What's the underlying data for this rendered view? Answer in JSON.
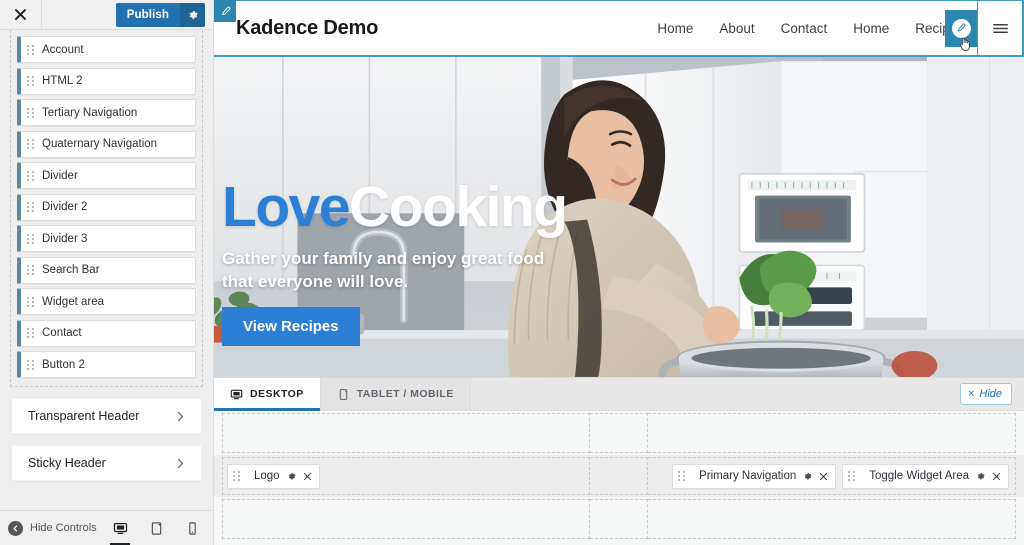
{
  "customizer": {
    "close_label": "Close",
    "publish_label": "Publish",
    "publish_settings_label": "Publish settings",
    "hide_controls_label": "Hide Controls",
    "devices": [
      {
        "name": "desktop",
        "label": "Desktop",
        "active": true
      },
      {
        "name": "tablet",
        "label": "Tablet",
        "active": false
      },
      {
        "name": "mobile",
        "label": "Mobile",
        "active": false
      }
    ]
  },
  "sidebar": {
    "available_items": [
      {
        "label": "Account"
      },
      {
        "label": "HTML 2"
      },
      {
        "label": "Tertiary Navigation"
      },
      {
        "label": "Quaternary Navigation"
      },
      {
        "label": "Divider"
      },
      {
        "label": "Divider 2"
      },
      {
        "label": "Divider 3"
      },
      {
        "label": "Search Bar"
      },
      {
        "label": "Widget area"
      },
      {
        "label": "Contact"
      },
      {
        "label": "Button 2"
      }
    ],
    "panels": [
      {
        "label": "Transparent Header"
      },
      {
        "label": "Sticky Header"
      }
    ]
  },
  "preview": {
    "site_title": "Kadence Demo",
    "nav_items": [
      {
        "label": "Home"
      },
      {
        "label": "About"
      },
      {
        "label": "Contact"
      },
      {
        "label": "Home"
      },
      {
        "label": "Recipes"
      }
    ],
    "hero": {
      "heading_accent": "Love",
      "heading_rest": "Cooking",
      "subheading": "Gather your family and enjoy great food that everyone will love.",
      "button_label": "View Recipes"
    }
  },
  "builder": {
    "tabs": [
      {
        "label": "DESKTOP",
        "active": true
      },
      {
        "label": "TABLET / MOBILE",
        "active": false
      }
    ],
    "hide_label": "Hide",
    "hide_x": "×",
    "rows": [
      {
        "name": "top-row",
        "left": [],
        "center": [],
        "right": []
      },
      {
        "name": "main-row",
        "left": [
          {
            "label": "Logo"
          }
        ],
        "center": [],
        "right": [
          {
            "label": "Primary Navigation"
          },
          {
            "label": "Toggle Widget Area"
          }
        ]
      },
      {
        "name": "bottom-row",
        "left": [],
        "center": [],
        "right": []
      }
    ]
  },
  "colors": {
    "accent_blue": "#2271b1",
    "hero_accent": "#2b7fd4",
    "highlight_border": "#3d9cc4",
    "item_border": "#5a87a8"
  }
}
